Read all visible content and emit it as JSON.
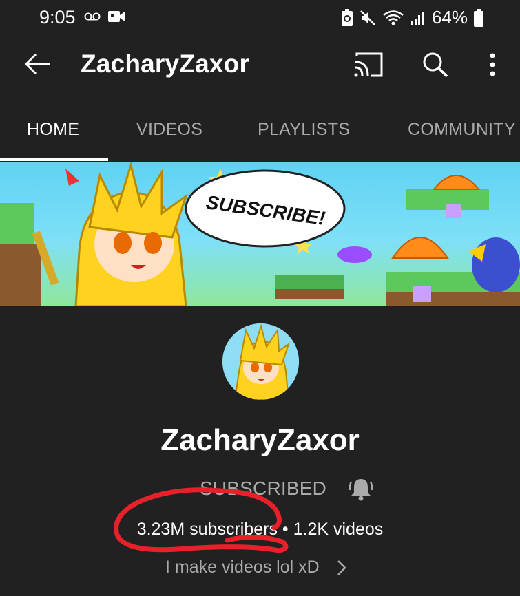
{
  "status_bar": {
    "time": "9:05",
    "battery": "64%",
    "icons": [
      "voicemail-icon",
      "video-icon",
      "battery-saver-icon",
      "mute-icon",
      "wifi-icon",
      "signal-icon",
      "battery-icon"
    ]
  },
  "app_bar": {
    "title": "ZacharyZaxor",
    "actions": [
      "cast-icon",
      "search-icon",
      "more-vert-icon"
    ]
  },
  "tabs": [
    {
      "label": "HOME",
      "active": true
    },
    {
      "label": "VIDEOS",
      "active": false
    },
    {
      "label": "PLAYLISTS",
      "active": false
    },
    {
      "label": "COMMUNITY",
      "active": false
    }
  ],
  "banner": {
    "text": "SUBSCRIBE!"
  },
  "channel": {
    "name": "ZacharyZaxor",
    "subscribe_state": "SUBSCRIBED",
    "stats": "3.23M subscribers • 1.2K videos",
    "description": "I make videos lol xD"
  },
  "colors": {
    "background": "#212121",
    "muted_text": "#aaaaaa",
    "annotation": "#e8202a"
  }
}
